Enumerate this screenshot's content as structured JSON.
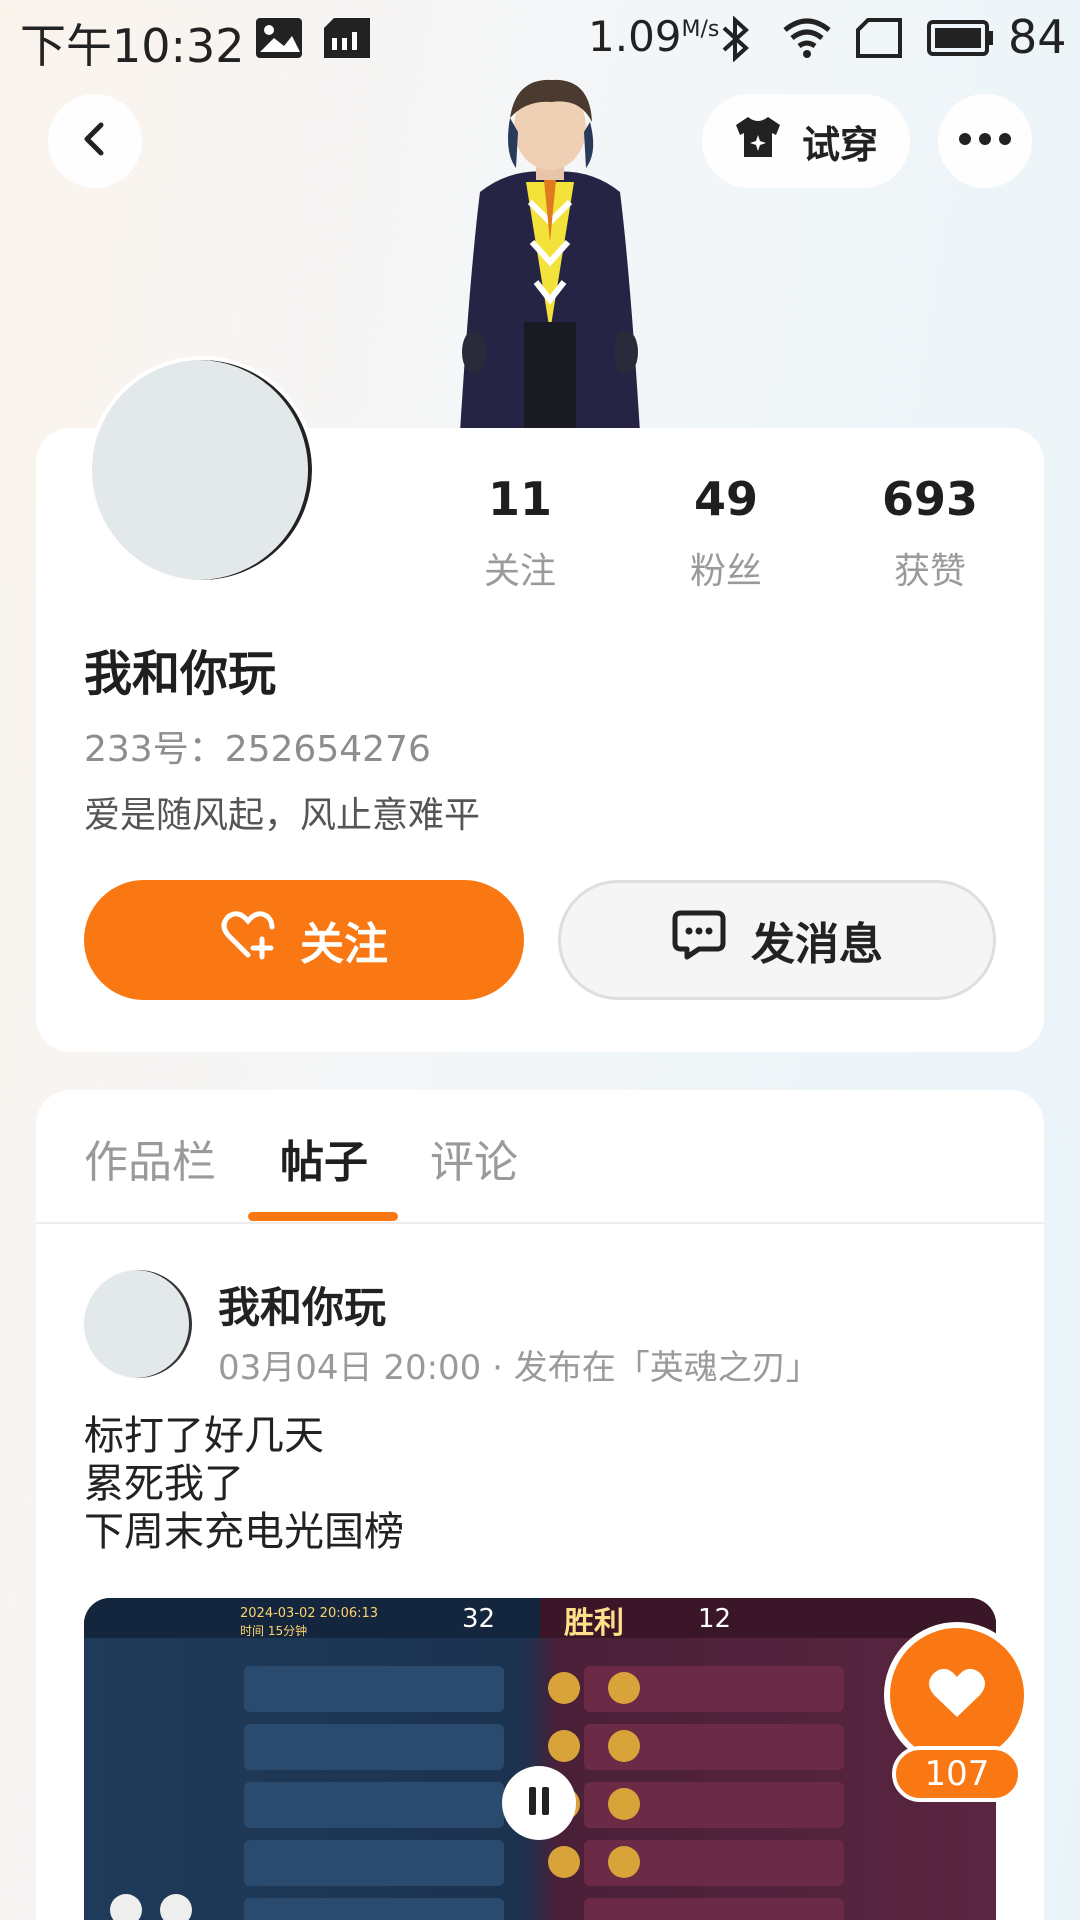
{
  "status_bar": {
    "time": "下午10:32",
    "net_speed": "1.09",
    "net_speed_unit": "M/s",
    "battery": "84",
    "icons": [
      "image-icon",
      "sim-icon",
      "bluetooth-icon",
      "wifi-icon",
      "screen-icon",
      "battery-icon"
    ]
  },
  "header": {
    "back_icon": "chevron-left-icon",
    "tryon_label": "试穿",
    "tryon_icon": "shirt-icon",
    "more_icon": "more-horizontal-icon"
  },
  "profile": {
    "stats": [
      {
        "value": "11",
        "label": "关注"
      },
      {
        "value": "49",
        "label": "粉丝"
      },
      {
        "value": "693",
        "label": "获赞"
      }
    ],
    "name": "我和你玩",
    "uid": "233号：252654276",
    "bio": "爱是随风起，风止意难平",
    "follow_label": "关注",
    "message_label": "发消息"
  },
  "tabs": [
    {
      "label": "作品栏",
      "active": false
    },
    {
      "label": "帖子",
      "active": true
    },
    {
      "label": "评论",
      "active": false
    }
  ],
  "post": {
    "author": "我和你玩",
    "meta": "03月04日 20:00 · 发布在「英魂之刃」",
    "text_lines": [
      "标打了好几天",
      "累死我了",
      "下周末充电光国榜"
    ],
    "media": {
      "score_left": "32",
      "score_right": "12",
      "result": "胜利",
      "date": "2024-03-02 20:06:13",
      "duration": "时间 15分钟"
    },
    "like_count": "107"
  },
  "colors": {
    "accent": "#f97813",
    "card": "#ffffff",
    "muted_text": "#9a9a9a"
  }
}
